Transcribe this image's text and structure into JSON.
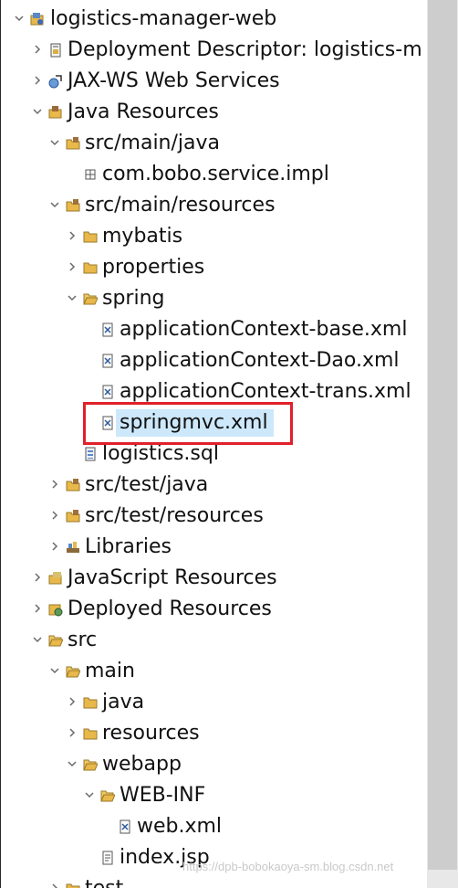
{
  "tree": {
    "project": "logistics-manager-web",
    "deployment_descriptor": "Deployment Descriptor: logistics-m",
    "jaxws": "JAX-WS Web Services",
    "java_resources": "Java Resources",
    "src_main_java": "src/main/java",
    "package_impl": "com.bobo.service.impl",
    "src_main_resources": "src/main/resources",
    "mybatis": "mybatis",
    "properties": "properties",
    "spring": "spring",
    "ctx_base": "applicationContext-base.xml",
    "ctx_dao": "applicationContext-Dao.xml",
    "ctx_trans": "applicationContext-trans.xml",
    "springmvc": "springmvc.xml",
    "logistics_sql": "logistics.sql",
    "src_test_java": "src/test/java",
    "src_test_resources": "src/test/resources",
    "libraries": "Libraries",
    "js_resources": "JavaScript Resources",
    "deployed_resources": "Deployed Resources",
    "src": "src",
    "main": "main",
    "java": "java",
    "resources": "resources",
    "webapp": "webapp",
    "web_inf": "WEB-INF",
    "web_xml": "web.xml",
    "index_jsp": "index.jsp",
    "test": "test"
  },
  "watermark": "https://dpb-bobokaoya-sm.blog.csdn.net",
  "colors": {
    "selection": "#cde8fb",
    "highlight_box": "#e0202a",
    "folder": "#e8b84a",
    "scrollbar_thumb": "#cdcdcd"
  }
}
